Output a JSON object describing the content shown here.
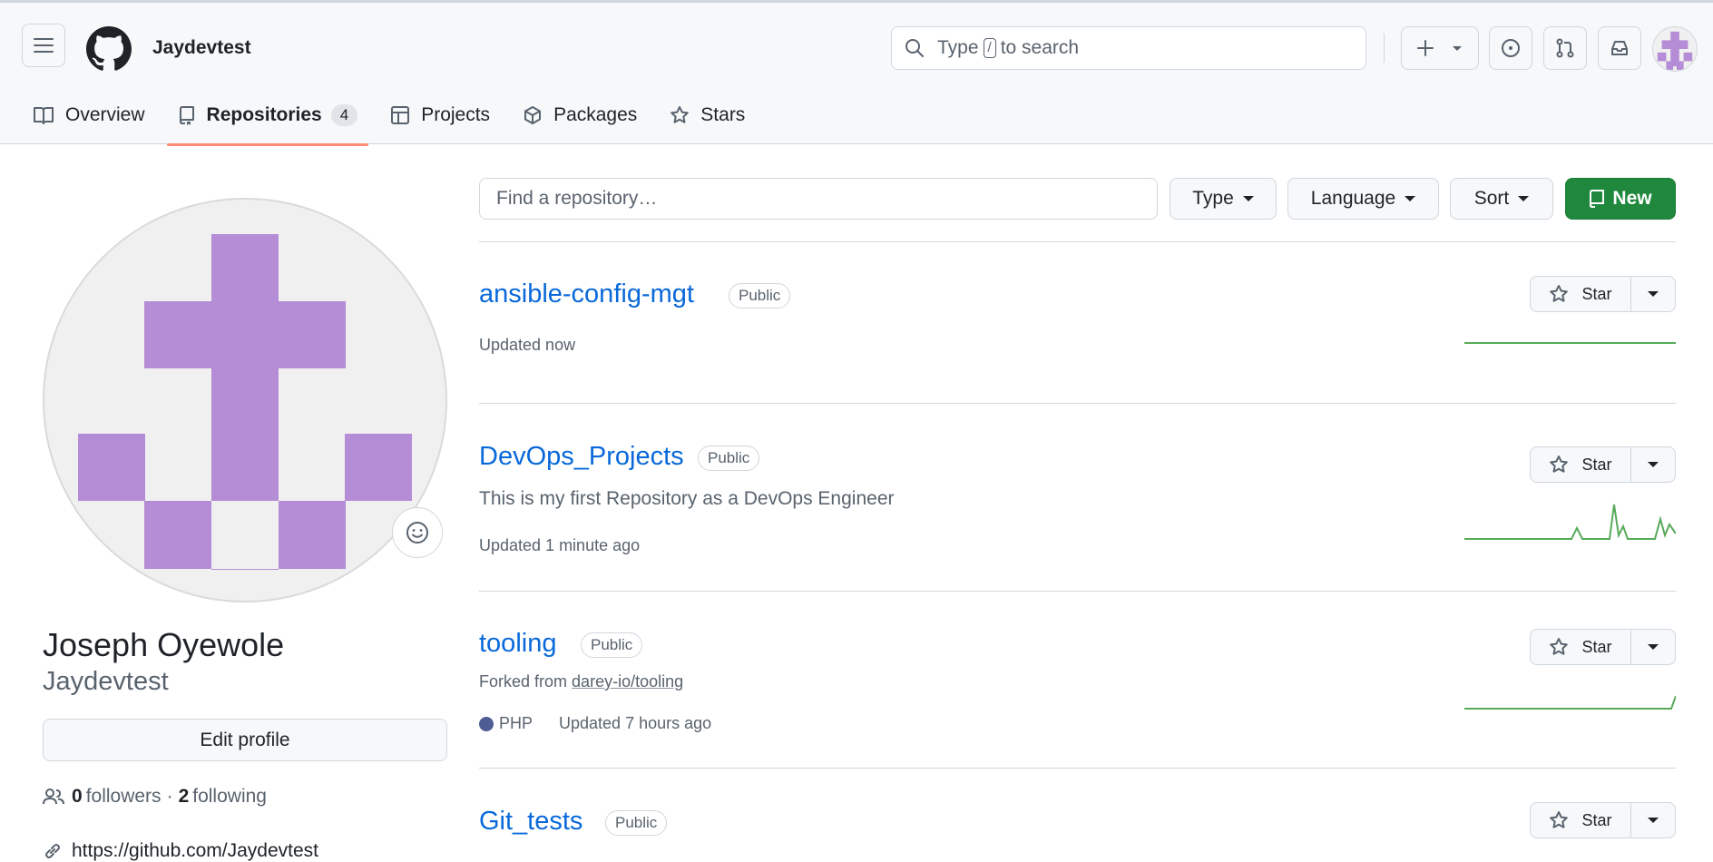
{
  "header": {
    "username": "Jaydevtest",
    "search_prefix": "Type",
    "search_key": "/",
    "search_suffix": "to search"
  },
  "tabs": [
    {
      "label": "Overview"
    },
    {
      "label": "Repositories",
      "count": "4"
    },
    {
      "label": "Projects"
    },
    {
      "label": "Packages"
    },
    {
      "label": "Stars"
    }
  ],
  "profile": {
    "full_name": "Joseph Oyewole",
    "login": "Jaydevtest",
    "edit_label": "Edit profile",
    "followers_count": "0",
    "followers_label": "followers",
    "separator": "·",
    "following_count": "2",
    "following_label": "following",
    "website": "https://github.com/Jaydevtest"
  },
  "filters": {
    "find_placeholder": "Find a repository…",
    "type_label": "Type",
    "language_label": "Language",
    "sort_label": "Sort",
    "new_label": "New"
  },
  "repos": [
    {
      "name": "ansible-config-mgt",
      "visibility": "Public",
      "description": "",
      "updated": "Updated now",
      "star_label": "Star"
    },
    {
      "name": "DevOps_Projects",
      "visibility": "Public",
      "description": "This is my first Repository as a DevOps Engineer",
      "updated": "Updated 1 minute ago",
      "star_label": "Star"
    },
    {
      "name": "tooling",
      "visibility": "Public",
      "fork_prefix": "Forked from",
      "fork_source": "darey-io/tooling",
      "language": "PHP",
      "updated": "Updated 7 hours ago",
      "star_label": "Star"
    },
    {
      "name": "Git_tests",
      "visibility": "Public",
      "star_label": "Star"
    }
  ],
  "colors": {
    "accent_tab": "#fd8c73",
    "link": "#0969da",
    "new_button": "#1f883d",
    "avatar_purple": "#b58dd6",
    "php": "#4F5D95",
    "sparkline": "#57ab5a"
  }
}
